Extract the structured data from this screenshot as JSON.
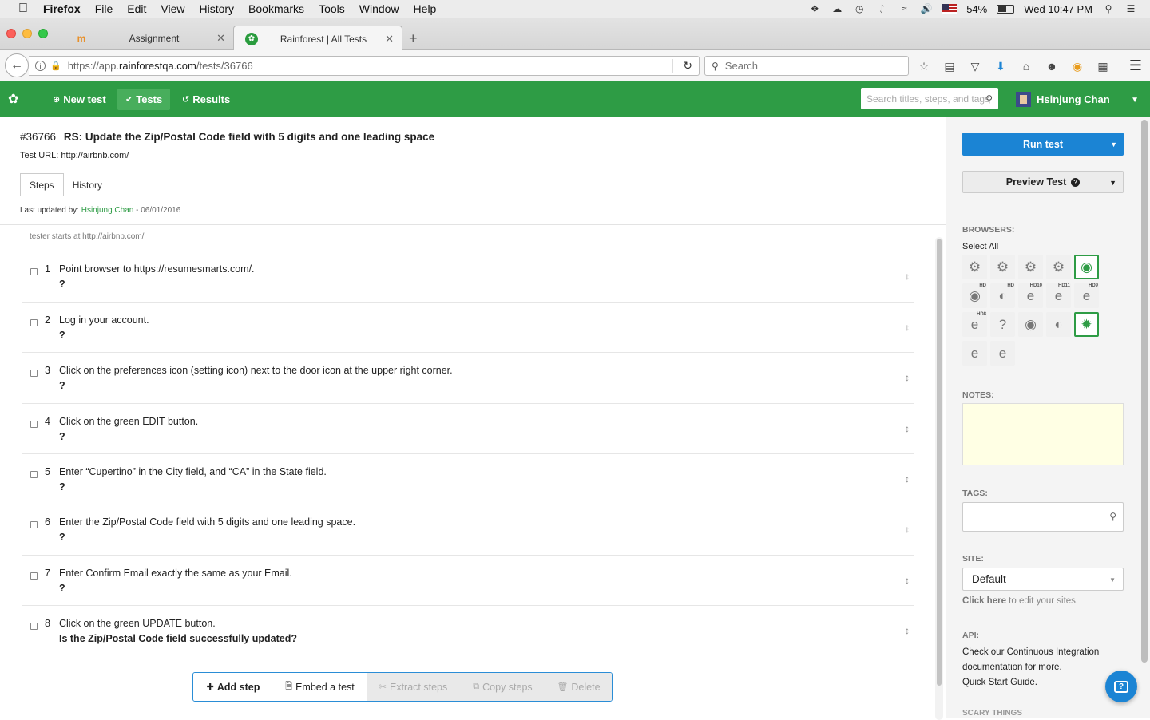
{
  "menubar": {
    "app": "Firefox",
    "items": [
      "File",
      "Edit",
      "View",
      "History",
      "Bookmarks",
      "Tools",
      "Window",
      "Help"
    ],
    "battery": "54%",
    "clock": "Wed 10:47 PM"
  },
  "browser": {
    "tabs": [
      {
        "label": "Assignment",
        "active": false
      },
      {
        "label": "Rainforest | All Tests",
        "active": true
      }
    ],
    "url_prefix": "https://app.",
    "url_domain": "rainforestqa.com",
    "url_path": "/tests/36766",
    "search_placeholder": "Search"
  },
  "app": {
    "nav": {
      "new_test": "New test",
      "tests": "Tests",
      "results": "Results"
    },
    "search_placeholder": "Search titles, steps, and tags",
    "user_name": "Hsinjung Chan",
    "brand_color": "#2e9c45"
  },
  "test": {
    "id": "#36766",
    "title": "RS: Update the Zip/Postal Code field with 5 digits and one leading space",
    "url_label": "Test URL:",
    "url": "http://airbnb.com/",
    "tabs": [
      "Steps",
      "History"
    ],
    "last_updated_label": "Last updated by:",
    "last_updated_by": "Hsinjung Chan",
    "last_updated_date": "- 06/01/2016",
    "start_note": "tester starts at http://airbnb.com/",
    "steps": [
      {
        "num": "1",
        "action": "Point browser to https://resumesmarts.com/.",
        "question": "?"
      },
      {
        "num": "2",
        "action": "Log in your account.",
        "question": "?"
      },
      {
        "num": "3",
        "action": "Click on the preferences icon (setting icon) next to the door icon at the upper right corner.",
        "question": "?"
      },
      {
        "num": "4",
        "action": "Click on the green EDIT button.",
        "question": "?"
      },
      {
        "num": "5",
        "action": "Enter “Cupertino” in the City field, and “CA” in the State field.",
        "question": "?"
      },
      {
        "num": "6",
        "action": "Enter the Zip/Postal Code field with 5 digits and one leading space.",
        "question": "?"
      },
      {
        "num": "7",
        "action": "Enter Confirm Email exactly the same as your Email.",
        "question": "?"
      },
      {
        "num": "8",
        "action": "Click on the green UPDATE button.",
        "question": "Is the Zip/Postal Code field successfully updated?"
      }
    ],
    "actions": {
      "add_step": "Add step",
      "embed": "Embed a test",
      "extract": "Extract steps",
      "copy": "Copy steps",
      "delete": "Delete"
    }
  },
  "sidebar": {
    "run_test": "Run test",
    "preview_test": "Preview Test",
    "browsers_label": "BROWSERS:",
    "select_all": "Select All",
    "notes_label": "NOTES:",
    "tags_label": "TAGS:",
    "site_label": "SITE:",
    "site_value": "Default",
    "site_help_link": "Click here",
    "site_help_text": " to edit your sites.",
    "api_label": "API:",
    "api_text_1": "Check our Continuous Integration documentation for more.",
    "api_text_2": "Quick Start Guide.",
    "more_label": "SCARY THINGS",
    "run_color": "#1b84d4"
  }
}
